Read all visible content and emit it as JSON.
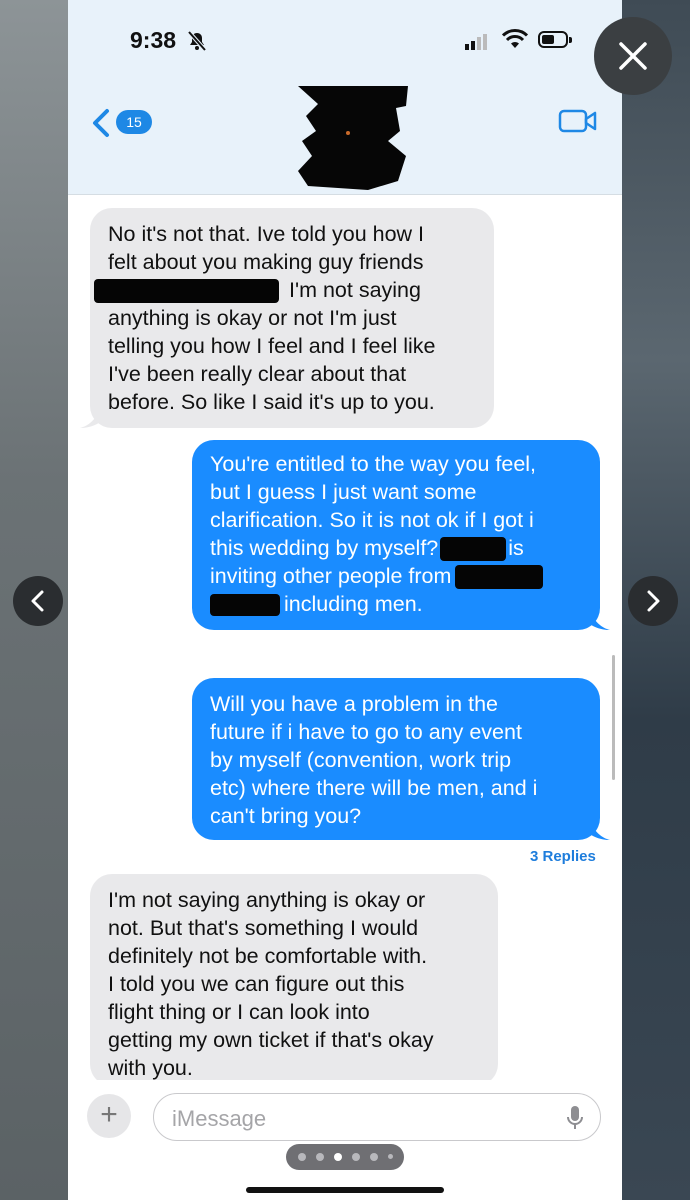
{
  "status_bar": {
    "time": "9:38"
  },
  "header": {
    "back_badge": "15"
  },
  "messages": [
    {
      "direction": "received",
      "lines": [
        "No it's not that. Ive told you how I",
        "felt about you making guy friends",
        "I'm not saying",
        "anything is okay or not I'm just",
        "telling you how I feel and I feel like",
        "I've been really clear about that",
        "before. So like I said it's up to you."
      ]
    },
    {
      "direction": "sent",
      "lines": [
        "You're entitled to the way you feel,",
        "but I guess I just want some",
        "clarification. So it is not ok if I got i",
        "this wedding by myself?",
        "is",
        "inviting other people from",
        "including men."
      ]
    },
    {
      "direction": "sent",
      "lines": [
        "Will you have a problem in the",
        "future if i have to go to any event",
        "by myself (convention, work trip",
        "etc) where there will be men, and i",
        "can't bring you?"
      ]
    },
    {
      "direction": "received",
      "lines": [
        "I'm not saying anything is okay or",
        "not. But that's something I would",
        "definitely not be comfortable with.",
        "I told you we can figure out this",
        "flight thing or I can look into",
        "getting my own ticket if that's okay",
        "with you."
      ]
    }
  ],
  "replies_link": "3 Replies",
  "composer": {
    "plus_label": "+",
    "placeholder": "iMessage"
  },
  "icons": {
    "close": "close-icon",
    "prev": "chevron-left-icon",
    "next": "chevron-right-icon",
    "video": "video-camera-icon",
    "mic": "microphone-icon"
  }
}
